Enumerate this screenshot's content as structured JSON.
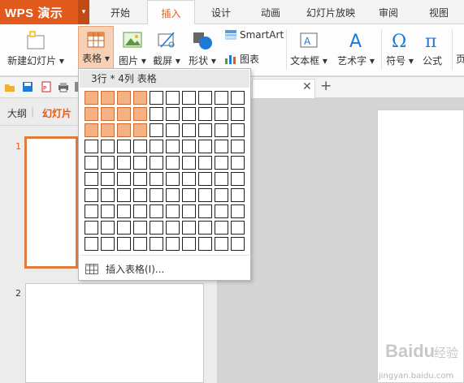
{
  "app": {
    "name": "WPS 演示",
    "accent": "#e15a1c"
  },
  "tabs": [
    "开始",
    "插入",
    "设计",
    "动画",
    "幻灯片放映",
    "审阅",
    "视图"
  ],
  "active_tab": "插入",
  "ribbon": {
    "new_slide": "新建幻灯片",
    "table": "表格",
    "picture": "图片",
    "screenshot": "截屏",
    "shape": "形状",
    "smartart": "SmartArt",
    "chart": "图表",
    "textbox": "文本框",
    "wordart": "艺术字",
    "symbol": "符号",
    "formula": "公式",
    "more_cut": "页"
  },
  "side_panel": {
    "tabs": [
      "大纲",
      "幻灯片"
    ],
    "active_tab": "幻灯片",
    "slide_numbers": [
      "1",
      "2"
    ]
  },
  "table_dropdown": {
    "header": "3行 * 4列 表格",
    "rows": 10,
    "cols": 10,
    "selected_rows": 3,
    "selected_cols": 4,
    "insert_label": "插入表格(I)...",
    "highlight_color": "#f4b183"
  },
  "watermark": {
    "brand": "Baidu",
    "cn": "经验",
    "url": "jingyan.baidu.com"
  }
}
